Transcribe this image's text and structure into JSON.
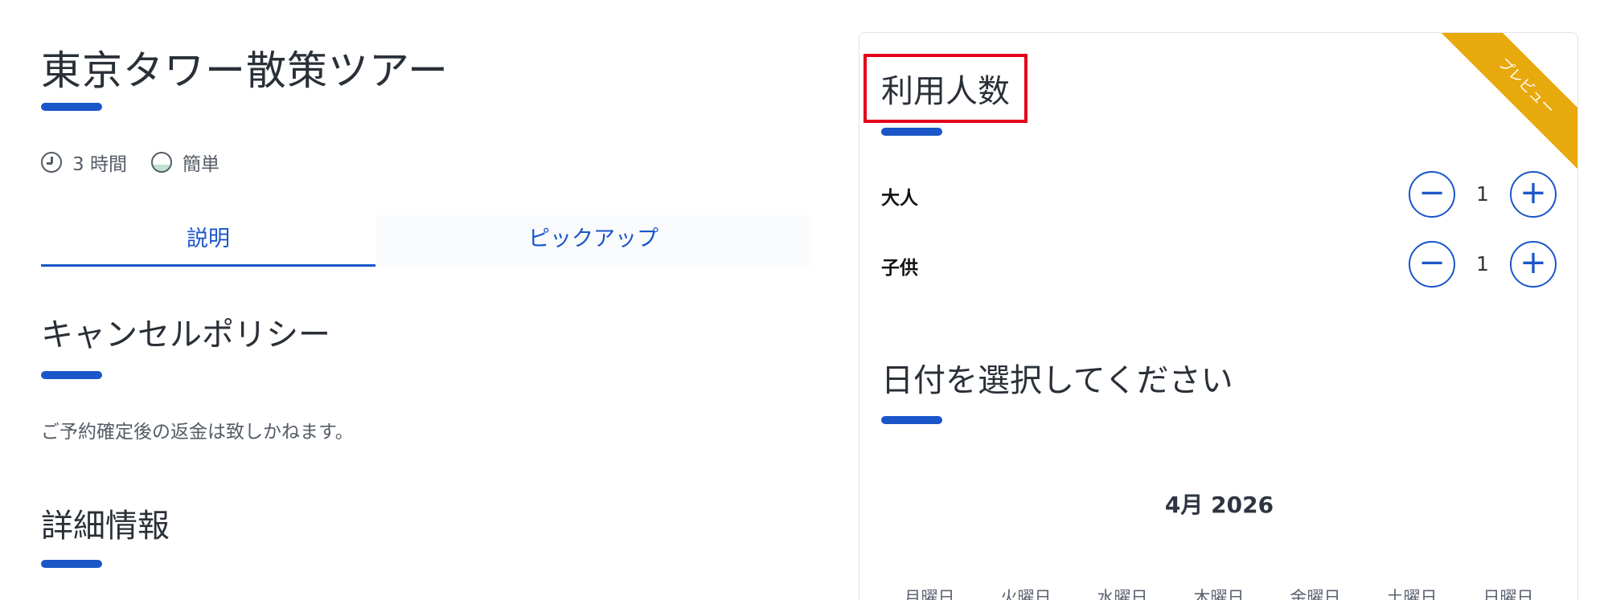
{
  "tour": {
    "title": "東京タワー散策ツアー",
    "duration": "3 時間",
    "difficulty": "簡単"
  },
  "tabs": [
    {
      "label": "説明",
      "active": true
    },
    {
      "label": "ピックアップ",
      "active": false
    }
  ],
  "cancellation": {
    "heading": "キャンセルポリシー",
    "text": "ご予約確定後の返金は致しかねます。"
  },
  "details": {
    "heading": "詳細情報"
  },
  "booking": {
    "ribbon": "プレビュー",
    "participants_heading": "利用人数",
    "adult_label": "大人",
    "adult_count": "1",
    "child_label": "子供",
    "child_count": "1",
    "minus_symbol": "−",
    "plus_symbol": "+",
    "date_heading": "日付を選択してください",
    "calendar_month": "4月 2026",
    "weekdays": [
      "月曜日",
      "火曜日",
      "水曜日",
      "木曜日",
      "金曜日",
      "土曜日",
      "日曜日"
    ]
  },
  "colors": {
    "accent": "#1a56c8",
    "ribbon": "#e8a90c",
    "highlight_box": "#e3001b"
  }
}
